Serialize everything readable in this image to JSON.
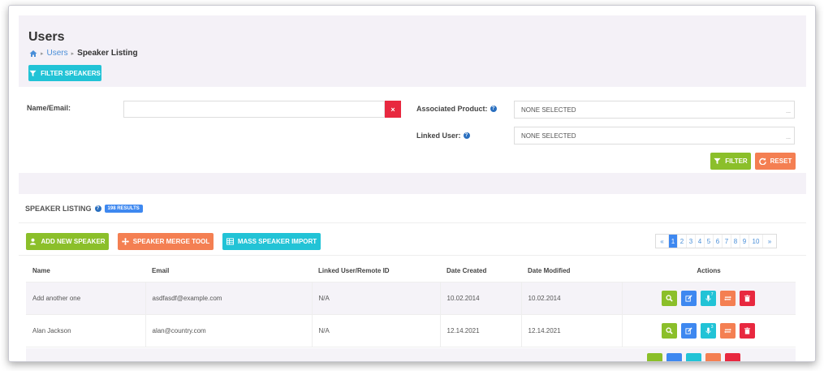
{
  "page": {
    "title": "Users"
  },
  "breadcrumb": {
    "link": "Users",
    "current": "Speaker Listing"
  },
  "filter_toggle": {
    "label": "FILTER SPEAKERS"
  },
  "filters": {
    "name_email_label": "Name/Email:",
    "name_email_value": "",
    "clear_symbol": "×",
    "product_label": "Associated Product:",
    "product_value": "NONE SELECTED",
    "linked_user_label": "Linked User:",
    "linked_user_value": "NONE SELECTED",
    "select_ellipsis": "...",
    "filter_button": "FILTER",
    "reset_button": "RESET"
  },
  "listing": {
    "title": "SPEAKER LISTING",
    "results_badge": "198 RESULTS",
    "add_button": "ADD NEW SPEAKER",
    "merge_button": "SPEAKER MERGE TOOL",
    "import_button": "MASS SPEAKER IMPORT"
  },
  "pagination": {
    "prev": "«",
    "next": "»",
    "pages": [
      "1",
      "2",
      "3",
      "4",
      "5",
      "6",
      "7",
      "8",
      "9",
      "10"
    ],
    "current": "1"
  },
  "table": {
    "columns": [
      "Name",
      "Email",
      "Linked User/Remote ID",
      "Date Created",
      "Date Modified",
      "Actions"
    ],
    "rows": [
      {
        "name": "Add another one",
        "email": "asdfasdf@example.com",
        "linked": "N/A",
        "created": "10.02.2014",
        "modified": "10.02.2014",
        "mic_count": "7"
      },
      {
        "name": "Alan Jackson",
        "email": "alan@country.com",
        "linked": "N/A",
        "created": "12.14.2021",
        "modified": "12.14.2021",
        "mic_count": "3"
      }
    ]
  },
  "colors": {
    "cyan": "#22c3d6",
    "green": "#8bbf2a",
    "orange": "#f47f52",
    "blue": "#3e88f0",
    "red": "#e8283f"
  },
  "icons": [
    "home-icon",
    "filter-icon",
    "question-icon",
    "clear-icon",
    "refresh-icon",
    "user-icon",
    "merge-icon",
    "table-icon",
    "search-icon",
    "edit-icon",
    "microphone-icon",
    "transfer-icon",
    "trash-icon"
  ]
}
